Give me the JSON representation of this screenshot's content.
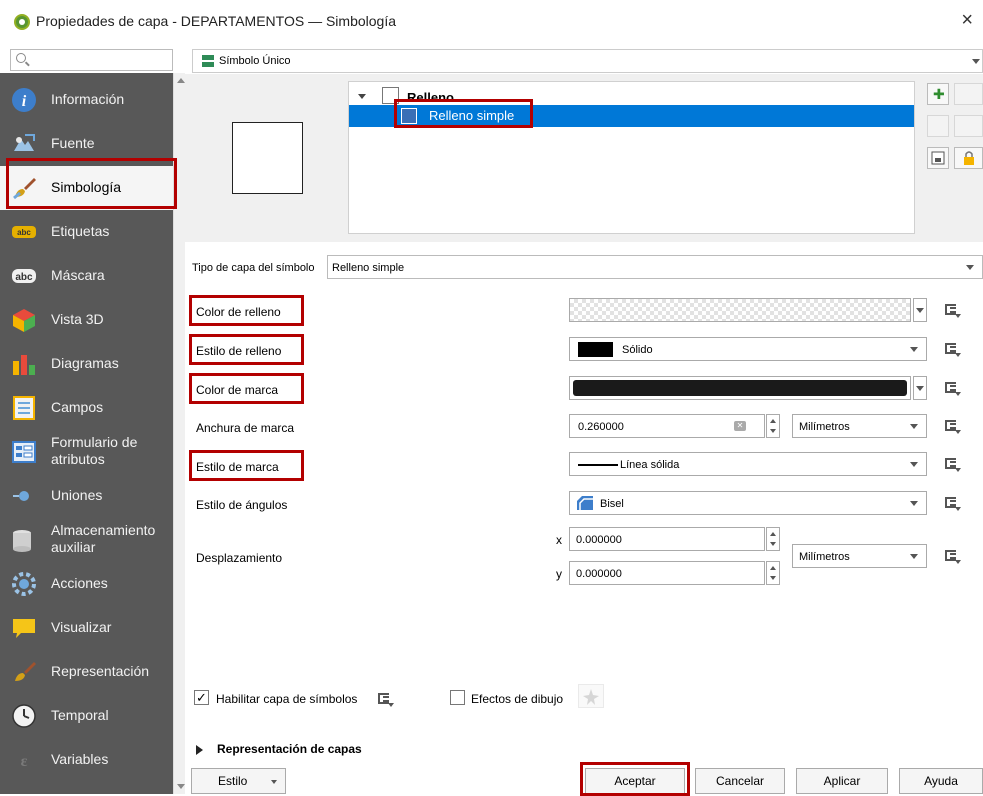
{
  "window": {
    "title": "Propiedades de capa - DEPARTAMENTOS — Simbología",
    "close_glyph": "×"
  },
  "sidebar": {
    "search_placeholder": "",
    "items": [
      {
        "label": "Información",
        "icon": "info-icon"
      },
      {
        "label": "Fuente",
        "icon": "source-icon"
      },
      {
        "label": "Simbología",
        "icon": "paintbrush-icon",
        "active": true
      },
      {
        "label": "Etiquetas",
        "icon": "labels-icon"
      },
      {
        "label": "Máscara",
        "icon": "mask-icon"
      },
      {
        "label": "Vista 3D",
        "icon": "cube-3d-icon"
      },
      {
        "label": "Diagramas",
        "icon": "diagram-icon"
      },
      {
        "label": "Campos",
        "icon": "fields-icon"
      },
      {
        "label": "Formulario de atributos",
        "icon": "form-icon"
      },
      {
        "label": "Uniones",
        "icon": "join-icon"
      },
      {
        "label": "Almacenamiento auxiliar",
        "icon": "storage-icon"
      },
      {
        "label": "Acciones",
        "icon": "actions-icon"
      },
      {
        "label": "Visualizar",
        "icon": "display-icon"
      },
      {
        "label": "Representación",
        "icon": "rendering-icon"
      },
      {
        "label": "Temporal",
        "icon": "clock-icon"
      },
      {
        "label": "Variables",
        "icon": "variables-icon"
      }
    ]
  },
  "renderer": {
    "selected": "Símbolo Único"
  },
  "symbol_tree": {
    "root": "Relleno",
    "child": "Relleno simple"
  },
  "symbol_layer": {
    "type_label": "Tipo de capa del símbolo",
    "type_value": "Relleno simple",
    "fill_color_label": "Color de relleno",
    "fill_style_label": "Estilo de relleno",
    "fill_style_value": "Sólido",
    "stroke_color_label": "Color de marca",
    "stroke_width_label": "Anchura de marca",
    "stroke_width_value": "0.260000",
    "stroke_width_unit": "Milímetros",
    "stroke_style_label": "Estilo de marca",
    "stroke_style_value": "Línea sólida",
    "join_style_label": "Estilo de ángulos",
    "join_style_value": "Bisel",
    "offset_label": "Desplazamiento",
    "offset_x_label": "x",
    "offset_x_value": "0.000000",
    "offset_y_label": "y",
    "offset_y_value": "0.000000",
    "offset_unit": "Milímetros"
  },
  "options": {
    "enable_layer_label": "Habilitar capa de símbolos",
    "enable_layer_checked": true,
    "draw_effects_label": "Efectos de dibujo",
    "draw_effects_checked": false,
    "layer_rendering_label": "Representación de capas"
  },
  "buttons": {
    "style": "Estilo",
    "ok": "Aceptar",
    "cancel": "Cancelar",
    "apply": "Aplicar",
    "help": "Ayuda"
  },
  "colors": {
    "sidebar_bg": "#585858",
    "highlight_red": "#b30000",
    "selection_blue": "#0078d7",
    "fill_symbol": "#3a6fb6",
    "stroke_color": "#1a1a1a"
  }
}
